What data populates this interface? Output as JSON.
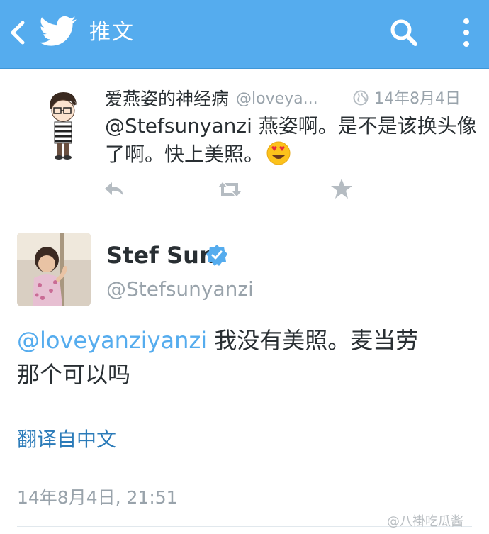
{
  "appbar": {
    "title": "推文",
    "back_icon": "back-arrow-icon",
    "logo_icon": "twitter-bird-icon",
    "search_icon": "search-icon",
    "more_icon": "overflow-menu-icon",
    "bg_color": "#55acee"
  },
  "reply_tweet": {
    "name": "爱燕姿的神经病",
    "handle": "@loveya...",
    "date": "14年8月4日",
    "text": "@Stefsunyanzi 燕姿啊。是不是该换头像了啊。快上美照。",
    "emoji": "heart-eyes-emoji",
    "actions": [
      "reply-icon",
      "retweet-icon",
      "favorite-icon"
    ]
  },
  "main_tweet": {
    "name": "Stef Sun",
    "verified": true,
    "handle": "@Stefsunyanzi",
    "mention": "@loveyanziyanzi",
    "text_line1": " 我没有美照。麦当劳",
    "text_line2": "那个可以吗",
    "translate_label": "翻译自中文",
    "timestamp": "14年8月4日, 21:51"
  },
  "watermark": "@八褂吃瓜酱",
  "colors": {
    "accent": "#55acee",
    "link": "#2b7bb9",
    "text": "#292f33",
    "muted": "#99a3ab"
  }
}
